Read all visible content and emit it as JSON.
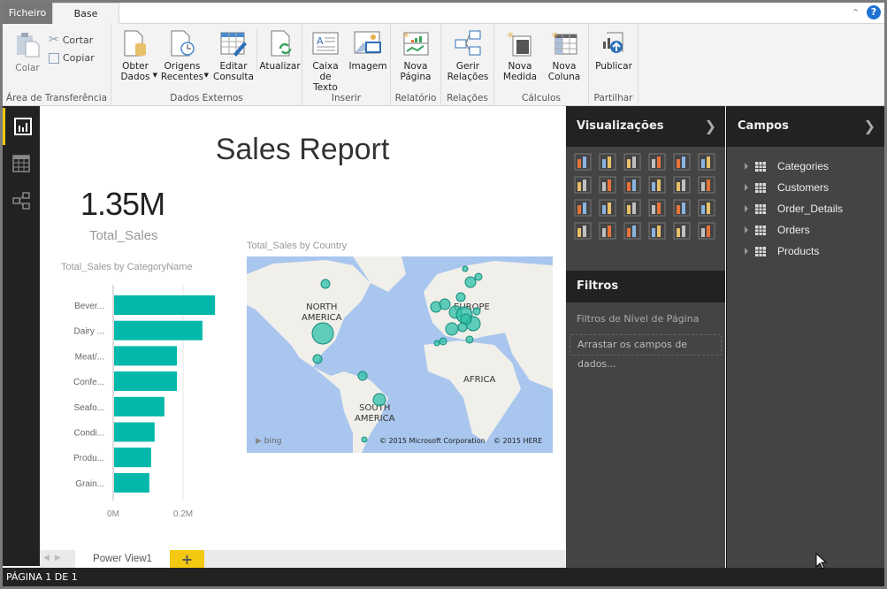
{
  "tabs": {
    "file": "Ficheiro",
    "base": "Base"
  },
  "ribbon": {
    "groups": [
      {
        "label": "Área de Transferência",
        "paste": "Colar",
        "cut": "Cortar",
        "copy": "Copiar"
      },
      {
        "label": "Dados Externos",
        "buttons": [
          "Obter\nDados",
          "Origens\nRecentes",
          "Editar\nConsulta",
          "Atualizar"
        ]
      },
      {
        "label": "Inserir",
        "buttons": [
          "Caixa\nde Texto",
          "Imagem"
        ]
      },
      {
        "label": "Relatório",
        "buttons": [
          "Nova\nPágina"
        ]
      },
      {
        "label": "Relações",
        "buttons": [
          "Gerir\nRelações"
        ]
      },
      {
        "label": "Cálculos",
        "buttons": [
          "Nova\nMedida",
          "Nova\nColuna"
        ]
      },
      {
        "label": "Partilhar",
        "buttons": [
          "Publicar"
        ]
      }
    ]
  },
  "report": {
    "title": "Sales Report",
    "card": {
      "value": "1.35M",
      "label": "Total_Sales"
    },
    "bar_title": "Total_Sales by CategoryName",
    "map_title": "Total_Sales by Country",
    "map_labels": [
      "NORTH\nAMERICA",
      "EUROPE",
      "AFRICA",
      "SOUTH\nAMERICA"
    ],
    "map_credits": {
      "bing": "bing",
      "ms": "© 2015 Microsoft Corporation",
      "here": "© 2015 HERE"
    }
  },
  "chart_data": {
    "type": "bar",
    "orientation": "horizontal",
    "title": "Total_Sales by CategoryName",
    "categories": [
      "Bever...",
      "Dairy ...",
      "Meat/...",
      "Confe...",
      "Seafo...",
      "Condi...",
      "Produ...",
      "Grain..."
    ],
    "values": [
      0.289,
      0.253,
      0.18,
      0.18,
      0.144,
      0.116,
      0.106,
      0.101
    ],
    "unit": "M",
    "xticks": [
      "0M",
      "0.2M"
    ],
    "xlim": [
      0,
      0.3
    ],
    "grid": true,
    "color": "#01b8aa"
  },
  "page_tabs": {
    "current": "Power View1",
    "add": "+"
  },
  "status": "PÁGINA 1 DE 1",
  "visualizations": {
    "title": "Visualizações"
  },
  "filters": {
    "title": "Filtros",
    "page_level": "Filtros de Nível de Página",
    "drop_placeholder": "Arrastar os campos de dados..."
  },
  "fields": {
    "title": "Campos",
    "tables": [
      "Categories",
      "Customers",
      "Order_Details",
      "Orders",
      "Products"
    ]
  }
}
